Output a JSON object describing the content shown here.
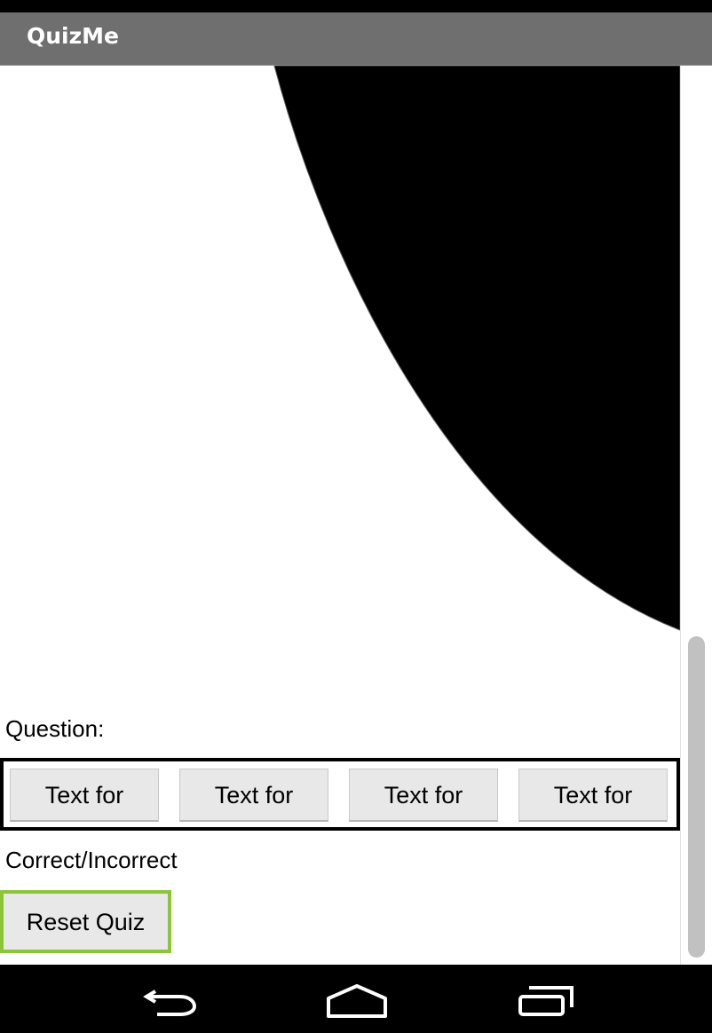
{
  "app": {
    "title": "QuizMe"
  },
  "quiz": {
    "image_icon": "quiz-image",
    "question_label": "Question:",
    "answers": [
      "Text for",
      "Text for",
      "Text for",
      "Text for"
    ],
    "result_label": "Correct/Incorrect",
    "reset_label": "Reset Quiz"
  },
  "navigation": {
    "back_icon": "back-arrow-icon",
    "home_icon": "home-icon",
    "recents_icon": "recent-apps-icon"
  },
  "colors": {
    "title_bar": "#6f6f6f",
    "reset_border": "#8cc43c",
    "button_face": "#e8e8e8"
  }
}
